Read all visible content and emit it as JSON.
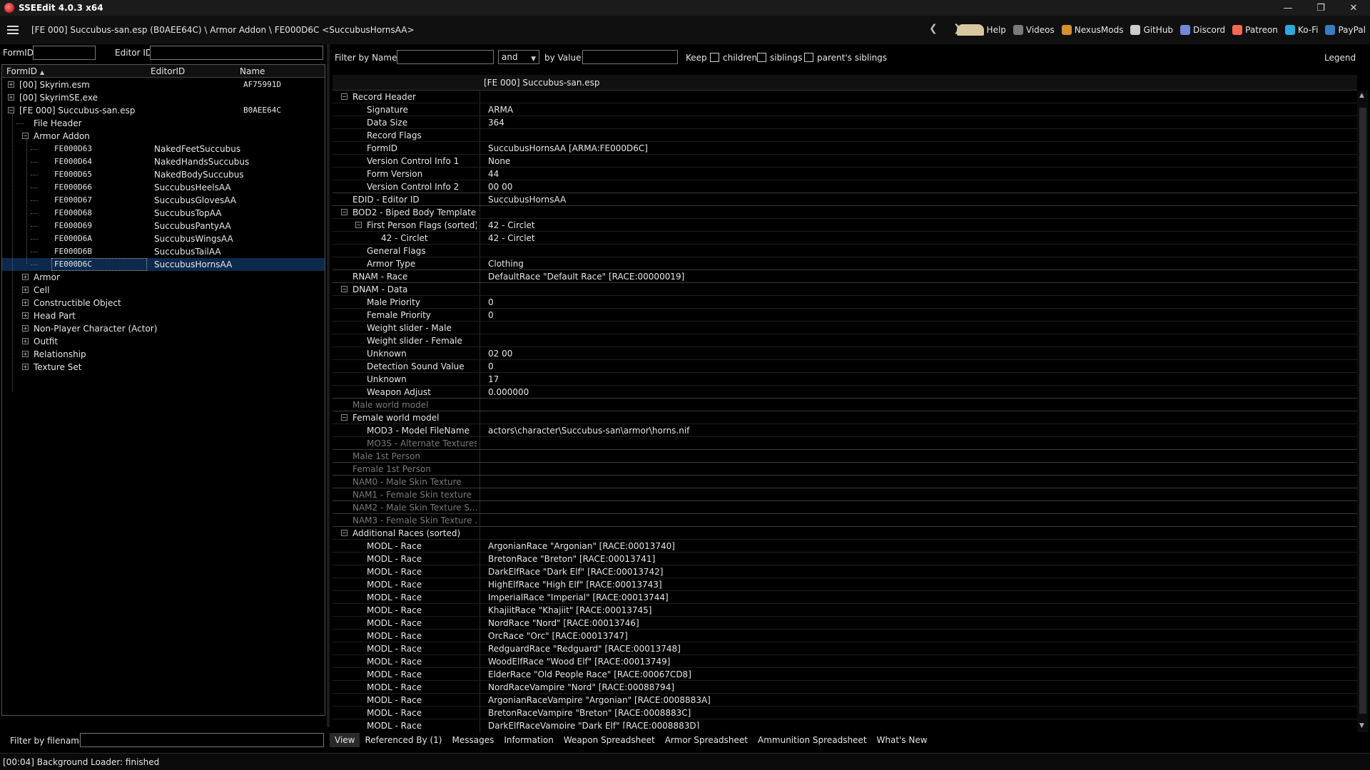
{
  "window": {
    "title": "SSEEdit 4.0.3 x64"
  },
  "pathbar": {
    "path": "[FE 000] Succubus-san.esp (B0AEE64C) \\ Armor Addon \\ FE000D6C <SuccubusHornsAA>",
    "links": [
      {
        "label": "Help",
        "icon": "book-icon",
        "color": "#d8c8a0"
      },
      {
        "label": "Videos",
        "icon": "film-icon",
        "color": "#7a7a7a"
      },
      {
        "label": "NexusMods",
        "icon": "nexus-icon",
        "color": "#d98f2b"
      },
      {
        "label": "GitHub",
        "icon": "github-icon",
        "color": "#cccccc"
      },
      {
        "label": "Discord",
        "icon": "discord-icon",
        "color": "#7289da"
      },
      {
        "label": "Patreon",
        "icon": "patreon-icon",
        "color": "#f96854"
      },
      {
        "label": "Ko-Fi",
        "icon": "kofi-icon",
        "color": "#29abe0"
      },
      {
        "label": "PayPal",
        "icon": "paypal-icon",
        "color": "#3b7bbf"
      }
    ]
  },
  "left": {
    "formid_label": "FormID",
    "editorid_label": "Editor ID",
    "columns": {
      "formid": "FormID",
      "editorid": "EditorID",
      "name": "Name"
    },
    "tree": [
      {
        "label": "[00] Skyrim.esm",
        "col3": "AF75991D",
        "indent": 0,
        "exp": "+"
      },
      {
        "label": "[00] SkyrimSE.exe",
        "col3": "",
        "indent": 0,
        "exp": "+"
      },
      {
        "label": "[FE 000] Succubus-san.esp",
        "col3": "B0AEE64C",
        "indent": 0,
        "exp": "-"
      },
      {
        "label": "File Header",
        "col3": "",
        "indent": 1,
        "exp": ""
      },
      {
        "label": "Armor Addon",
        "col3": "",
        "indent": 1,
        "exp": "-"
      },
      {
        "label": "FE000D63",
        "edid": "NakedFeetSuccubus",
        "indent": 2,
        "exp": ""
      },
      {
        "label": "FE000D64",
        "edid": "NakedHandsSuccubus",
        "indent": 2,
        "exp": ""
      },
      {
        "label": "FE000D65",
        "edid": "NakedBodySuccubus",
        "indent": 2,
        "exp": ""
      },
      {
        "label": "FE000D66",
        "edid": "SuccubusHeelsAA",
        "indent": 2,
        "exp": ""
      },
      {
        "label": "FE000D67",
        "edid": "SuccubusGlovesAA",
        "indent": 2,
        "exp": ""
      },
      {
        "label": "FE000D68",
        "edid": "SuccubusTopAA",
        "indent": 2,
        "exp": ""
      },
      {
        "label": "FE000D69",
        "edid": "SuccubusPantyAA",
        "indent": 2,
        "exp": ""
      },
      {
        "label": "FE000D6A",
        "edid": "SuccubusWingsAA",
        "indent": 2,
        "exp": ""
      },
      {
        "label": "FE000D6B",
        "edid": "SuccubusTailAA",
        "indent": 2,
        "exp": ""
      },
      {
        "label": "FE000D6C",
        "edid": "SuccubusHornsAA",
        "indent": 2,
        "exp": "",
        "selected": true
      },
      {
        "label": "Armor",
        "col3": "",
        "indent": 1,
        "exp": "+"
      },
      {
        "label": "Cell",
        "col3": "",
        "indent": 1,
        "exp": "+"
      },
      {
        "label": "Constructible Object",
        "col3": "",
        "indent": 1,
        "exp": "+"
      },
      {
        "label": "Head Part",
        "col3": "",
        "indent": 1,
        "exp": "+"
      },
      {
        "label": "Non-Player Character (Actor)",
        "col3": "",
        "indent": 1,
        "exp": "+"
      },
      {
        "label": "Outfit",
        "col3": "",
        "indent": 1,
        "exp": "+"
      },
      {
        "label": "Relationship",
        "col3": "",
        "indent": 1,
        "exp": "+"
      },
      {
        "label": "Texture Set",
        "col3": "",
        "indent": 1,
        "exp": "+"
      }
    ],
    "filter_filename_label": "Filter by filename:"
  },
  "right": {
    "filter_name_label": "Filter by Name:",
    "and_value": "and",
    "by_value_label": "by Value:",
    "keep_label": "Keep",
    "children_label": "children",
    "siblings_label": "siblings",
    "parents_siblings_label": "parent's siblings",
    "legend_label": "Legend",
    "grid_header": "[FE 000] Succubus-san.esp",
    "rows": [
      {
        "name": "Record Header",
        "value": "",
        "indent": 0,
        "exp": "-"
      },
      {
        "name": "Signature",
        "value": "ARMA",
        "indent": 1
      },
      {
        "name": "Data Size",
        "value": "364",
        "indent": 1
      },
      {
        "name": "Record Flags",
        "value": "",
        "indent": 1
      },
      {
        "name": "FormID",
        "value": "SuccubusHornsAA [ARMA:FE000D6C]",
        "indent": 1
      },
      {
        "name": "Version Control Info 1",
        "value": "None",
        "indent": 1
      },
      {
        "name": "Form Version",
        "value": "44",
        "indent": 1
      },
      {
        "name": "Version Control Info 2",
        "value": "00 00",
        "indent": 1,
        "sep": true
      },
      {
        "name": "EDID - Editor ID",
        "value": "SuccubusHornsAA",
        "indent": 0,
        "sep": true
      },
      {
        "name": "BOD2 - Biped Body Template",
        "value": "",
        "indent": 0,
        "exp": "-"
      },
      {
        "name": "First Person Flags (sorted)",
        "value": "42 - Circlet",
        "indent": 1,
        "exp": "-"
      },
      {
        "name": "42 - Circlet",
        "value": "42 - Circlet",
        "indent": 2
      },
      {
        "name": "General Flags",
        "value": "",
        "indent": 1
      },
      {
        "name": "Armor Type",
        "value": "Clothing",
        "indent": 1,
        "sep": true
      },
      {
        "name": "RNAM - Race",
        "value": "DefaultRace \"Default Race\" [RACE:00000019]",
        "indent": 0,
        "sep": true
      },
      {
        "name": "DNAM - Data",
        "value": "",
        "indent": 0,
        "exp": "-"
      },
      {
        "name": "Male Priority",
        "value": "0",
        "indent": 1
      },
      {
        "name": "Female Priority",
        "value": "0",
        "indent": 1
      },
      {
        "name": "Weight slider - Male",
        "value": "",
        "indent": 1
      },
      {
        "name": "Weight slider - Female",
        "value": "",
        "indent": 1
      },
      {
        "name": "Unknown",
        "value": "02 00",
        "indent": 1
      },
      {
        "name": "Detection Sound Value",
        "value": "0",
        "indent": 1
      },
      {
        "name": "Unknown",
        "value": "17",
        "indent": 1
      },
      {
        "name": "Weapon Adjust",
        "value": "0.000000",
        "indent": 1,
        "sep": true
      },
      {
        "name": "Male world model",
        "value": "",
        "indent": 0,
        "dim": true,
        "sep": true
      },
      {
        "name": "Female world model",
        "value": "",
        "indent": 0,
        "exp": "-"
      },
      {
        "name": "MOD3 - Model FileName",
        "value": "actors\\character\\Succubus-san\\armor\\horns.nif",
        "indent": 1
      },
      {
        "name": "MO3S - Alternate Textures",
        "value": "",
        "indent": 1,
        "dim": true,
        "sep": true
      },
      {
        "name": "Male 1st Person",
        "value": "",
        "indent": 0,
        "dim": true,
        "sep": true
      },
      {
        "name": "Female 1st Person",
        "value": "",
        "indent": 0,
        "dim": true,
        "sep": true
      },
      {
        "name": "NAM0 - Male Skin Texture",
        "value": "",
        "indent": 0,
        "dim": true,
        "sep": true
      },
      {
        "name": "NAM1 - Female Skin texture",
        "value": "",
        "indent": 0,
        "dim": true,
        "sep": true
      },
      {
        "name": "NAM2 - Male Skin Texture S...",
        "value": "",
        "indent": 0,
        "dim": true,
        "sep": true
      },
      {
        "name": "NAM3 - Female Skin Texture ...",
        "value": "",
        "indent": 0,
        "dim": true,
        "sep": true
      },
      {
        "name": "Additional Races (sorted)",
        "value": "",
        "indent": 0,
        "exp": "-"
      },
      {
        "name": "MODL - Race",
        "value": "ArgonianRace \"Argonian\" [RACE:00013740]",
        "indent": 1
      },
      {
        "name": "MODL - Race",
        "value": "BretonRace \"Breton\" [RACE:00013741]",
        "indent": 1
      },
      {
        "name": "MODL - Race",
        "value": "DarkElfRace \"Dark Elf\" [RACE:00013742]",
        "indent": 1
      },
      {
        "name": "MODL - Race",
        "value": "HighElfRace \"High Elf\" [RACE:00013743]",
        "indent": 1
      },
      {
        "name": "MODL - Race",
        "value": "ImperialRace \"Imperial\" [RACE:00013744]",
        "indent": 1
      },
      {
        "name": "MODL - Race",
        "value": "KhajiitRace \"Khajiit\" [RACE:00013745]",
        "indent": 1
      },
      {
        "name": "MODL - Race",
        "value": "NordRace \"Nord\" [RACE:00013746]",
        "indent": 1
      },
      {
        "name": "MODL - Race",
        "value": "OrcRace \"Orc\" [RACE:00013747]",
        "indent": 1
      },
      {
        "name": "MODL - Race",
        "value": "RedguardRace \"Redguard\" [RACE:00013748]",
        "indent": 1
      },
      {
        "name": "MODL - Race",
        "value": "WoodElfRace \"Wood Elf\" [RACE:00013749]",
        "indent": 1
      },
      {
        "name": "MODL - Race",
        "value": "ElderRace \"Old People Race\" [RACE:00067CD8]",
        "indent": 1
      },
      {
        "name": "MODL - Race",
        "value": "NordRaceVampire \"Nord\" [RACE:00088794]",
        "indent": 1
      },
      {
        "name": "MODL - Race",
        "value": "ArgonianRaceVampire \"Argonian\" [RACE:0008883A]",
        "indent": 1
      },
      {
        "name": "MODL - Race",
        "value": "BretonRaceVampire \"Breton\" [RACE:0008883C]",
        "indent": 1
      },
      {
        "name": "MODL - Race",
        "value": "DarkElfRaceVampire \"Dark Elf\" [RACE:0008883D]",
        "indent": 1
      }
    ]
  },
  "tabs": [
    {
      "label": "View",
      "active": true
    },
    {
      "label": "Referenced By (1)"
    },
    {
      "label": "Messages"
    },
    {
      "label": "Information"
    },
    {
      "label": "Weapon Spreadsheet"
    },
    {
      "label": "Armor Spreadsheet"
    },
    {
      "label": "Ammunition Spreadsheet"
    },
    {
      "label": "What's New"
    }
  ],
  "status": "[00:04] Background Loader: finished"
}
